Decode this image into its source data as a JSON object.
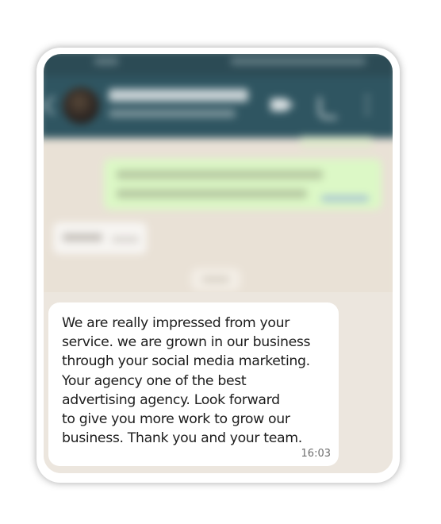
{
  "colors": {
    "header": "#2f5561",
    "status_bar": "#2c4b55",
    "chat_background": "#ece5dd",
    "outgoing_bubble": "#dcf8c6",
    "incoming_bubble": "#ffffff"
  },
  "header": {
    "back_icon": "arrow-left-icon",
    "avatar_icon": "contact-avatar",
    "video_icon": "video-call-icon",
    "call_icon": "phone-icon",
    "menu_icon": "more-vert-icon"
  },
  "message": {
    "lines": [
      "We are really impressed from your",
      "service. we are grown in our business",
      "through your social media marketing.",
      "Your agency one of the best",
      "advertising agency. Look forward",
      "to give you more work to grow our",
      "business. Thank you and your team."
    ],
    "time": "16:03"
  }
}
